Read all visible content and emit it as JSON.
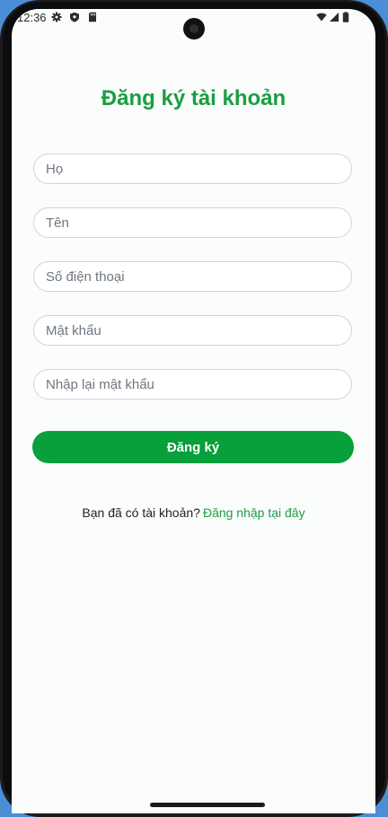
{
  "status_bar": {
    "time": "12:36",
    "left_icons": [
      "gear-icon",
      "shield-icon",
      "sd-card-icon"
    ],
    "right_icons": [
      "wifi-icon",
      "signal-icon",
      "battery-icon"
    ]
  },
  "page": {
    "title": "Đăng ký tài khoản"
  },
  "form": {
    "last_name_placeholder": "Họ",
    "first_name_placeholder": "Tên",
    "phone_placeholder": "Số điện thoại",
    "password_placeholder": "Mật khẩu",
    "confirm_password_placeholder": "Nhập lại mật khẩu",
    "submit_label": "Đăng ký"
  },
  "footer": {
    "question": "Bạn đã có tài khoản?",
    "login_link": "Đăng nhập tại đây"
  },
  "colors": {
    "brand_green": "#1a9e42",
    "button_green": "#07a03b",
    "background": "#fbfcfc"
  }
}
